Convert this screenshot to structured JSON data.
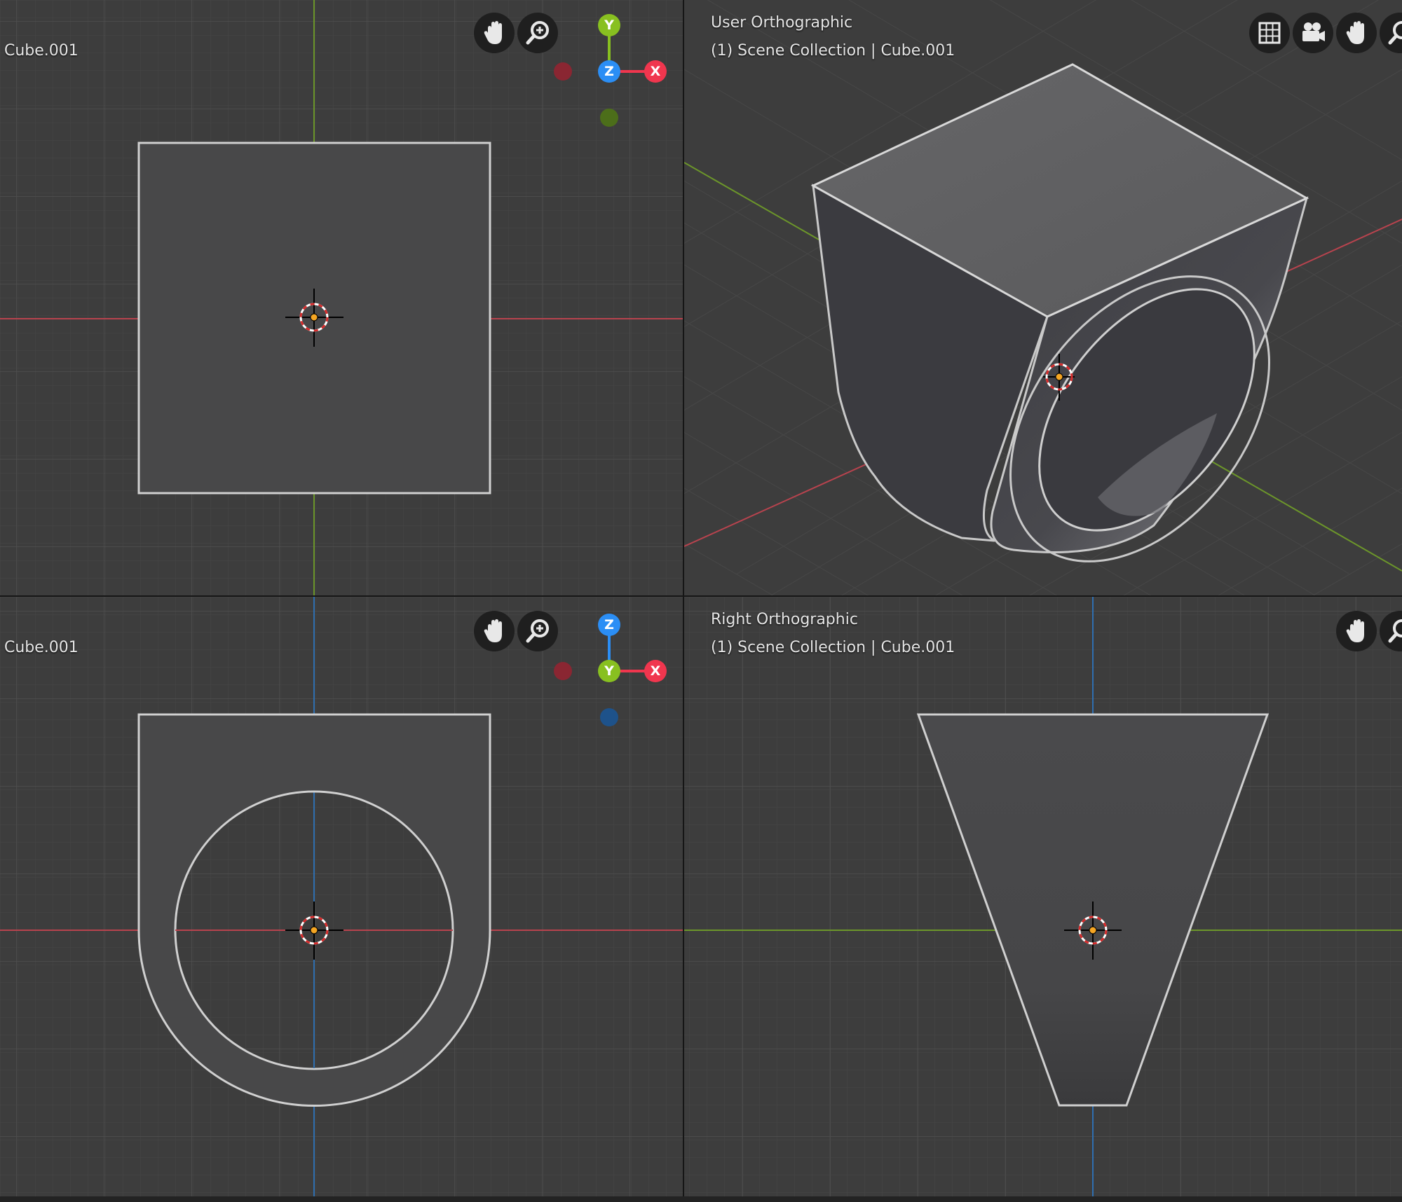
{
  "viewports": {
    "top_left": {
      "object_label": "Cube.001",
      "gizmo": {
        "up_axis": "Y",
        "center_axis": "Z",
        "right_axis": "X"
      }
    },
    "top_right": {
      "view_name": "User Orthographic",
      "collection_label": "(1) Scene Collection | Cube.001",
      "nav_icons": [
        "grid-icon",
        "camera-icon",
        "hand-pan-icon",
        "zoom-icon"
      ]
    },
    "bottom_left": {
      "object_label": "Cube.001",
      "gizmo": {
        "up_axis": "Z",
        "center_axis": "Y",
        "right_axis": "X"
      }
    },
    "bottom_right": {
      "view_name": "Right Orthographic",
      "collection_label": "(1) Scene Collection | Cube.001",
      "nav_icons": [
        "hand-pan-icon",
        "zoom-icon"
      ]
    }
  },
  "colors": {
    "viewport_bg": "#3d3d3d",
    "grid_minor": "#464646",
    "grid_major": "#4e4e4e",
    "x_axis": "#b8434e",
    "y_axis": "#6c962a",
    "z_axis": "#2f6fb0",
    "object_fill": "#484849",
    "object_outline": "#cfcfcf",
    "gizmo_x": "#f0364e",
    "gizmo_y": "#88c020",
    "gizmo_z": "#2b8ef5",
    "gizmo_neg_x": "#8a2632",
    "gizmo_neg_y": "#4c6e1a",
    "gizmo_neg_z": "#1e528a"
  }
}
